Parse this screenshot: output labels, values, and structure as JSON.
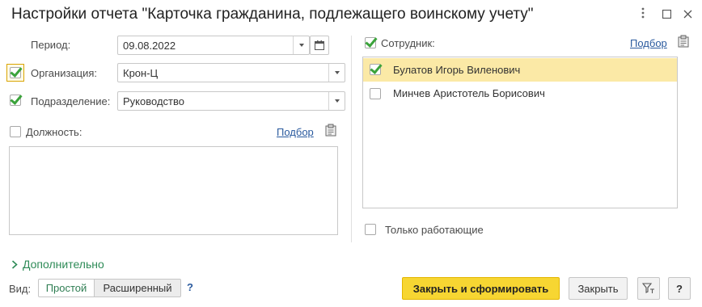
{
  "window": {
    "title": "Настройки отчета \"Карточка гражданина, подлежащего воинскому учету\"",
    "more_icon": "more-vertical-icon",
    "maximize_icon": "maximize-icon",
    "close_icon": "close-icon"
  },
  "left": {
    "period_label": "Период:",
    "period_value": "09.08.2022",
    "org_label": "Организация:",
    "org_value": "Крон-Ц",
    "org_checked": true,
    "dept_label": "Подразделение:",
    "dept_value": "Руководство",
    "dept_checked": true,
    "position_label": "Должность:",
    "position_checked": false,
    "position_pick_link": "Подбор"
  },
  "right": {
    "employee_label": "Сотрудник:",
    "employee_checked": true,
    "employee_pick_link": "Подбор",
    "employees": [
      {
        "name": "Булатов Игорь Виленович",
        "checked": true,
        "selected": true
      },
      {
        "name": "Минчев Аристотель Борисович",
        "checked": false,
        "selected": false
      }
    ],
    "only_working_label": "Только работающие",
    "only_working_checked": false
  },
  "footer": {
    "additional_label": "Дополнительно",
    "view_label": "Вид:",
    "view_simple": "Простой",
    "view_extended": "Расширенный",
    "view_selected": "Простой",
    "help_mark": "?",
    "submit_label": "Закрыть и сформировать",
    "close_label": "Закрыть",
    "help_label": "?",
    "filter_icon": "filter-icon"
  },
  "colors": {
    "accent_green": "#3ba33b",
    "primary_button": "#f7d632",
    "selected_row": "#fbe9a6",
    "link": "#2a5a9e",
    "additional_green": "#2e8b57"
  }
}
